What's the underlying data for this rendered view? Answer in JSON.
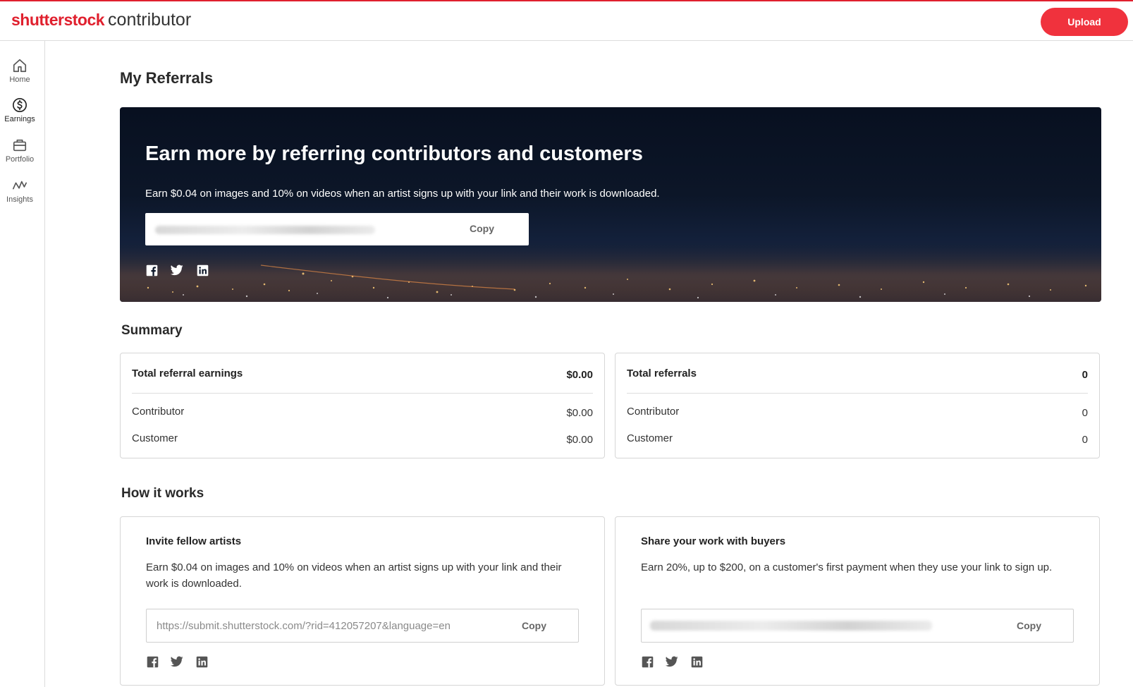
{
  "header": {
    "brand": "shutterstock",
    "product": "contributor",
    "upload_label": "Upload",
    "accent_color": "#e0202e"
  },
  "sidebar": {
    "items": [
      {
        "label": "Home",
        "icon": "home-icon"
      },
      {
        "label": "Earnings",
        "icon": "dollar-icon",
        "active": true
      },
      {
        "label": "Portfolio",
        "icon": "briefcase-icon"
      },
      {
        "label": "Insights",
        "icon": "insights-icon"
      }
    ]
  },
  "page": {
    "title": "My Referrals"
  },
  "hero": {
    "title": "Earn more by referring contributors and customers",
    "description": "Earn $0.04 on images and 10% on videos when an artist signs up with your link and their work is downloaded.",
    "copy_label": "Copy",
    "social": [
      "facebook-icon",
      "twitter-icon",
      "linkedin-icon"
    ]
  },
  "summary": {
    "title": "Summary",
    "earnings": {
      "label": "Total referral earnings",
      "total": "$0.00",
      "rows": [
        {
          "label": "Contributor",
          "value": "$0.00"
        },
        {
          "label": "Customer",
          "value": "$0.00"
        }
      ]
    },
    "referrals": {
      "label": "Total referrals",
      "total": "0",
      "rows": [
        {
          "label": "Contributor",
          "value": "0"
        },
        {
          "label": "Customer",
          "value": "0"
        }
      ]
    }
  },
  "how": {
    "title": "How it works",
    "cards": [
      {
        "title": "Invite fellow artists",
        "description": "Earn $0.04 on images and 10% on videos when an artist signs up with your link and their work is downloaded.",
        "link": "https://submit.shutterstock.com/?rid=412057207&language=en",
        "copy_label": "Copy"
      },
      {
        "title": "Share your work with buyers",
        "description": "Earn 20%, up to $200, on a customer's first payment when they use your link to sign up.",
        "link": "",
        "copy_label": "Copy"
      }
    ]
  }
}
